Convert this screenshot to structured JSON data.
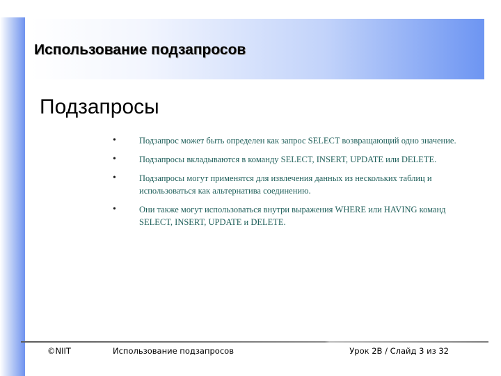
{
  "slide": {
    "title": "Использование подзапросов",
    "subheading": "Подзапросы",
    "bullet_symbol": "•",
    "bullets": [
      "Подзапрос может быть определен как запрос SELECT возвращающий одно значение.",
      "Подзапросы вкладываются в команду SELECT, INSERT, UPDATE или DELETE.",
      "Подзапросы могут применятся для извлечения данных из нескольких таблиц и использоваться как альтернатива соединению.",
      "Они также могут использоваться внутри выражения WHERE или HAVING команд SELECT, INSERT, UPDATE и DELETE."
    ]
  },
  "footer": {
    "copyright": "©NIIT",
    "topic": "Использование подзапросов",
    "slide_number": "Урок 2В / Слайд 3 из 32"
  },
  "colors": {
    "accent_blue": "#6d95f2",
    "bullet_text": "#1f5f5a"
  }
}
